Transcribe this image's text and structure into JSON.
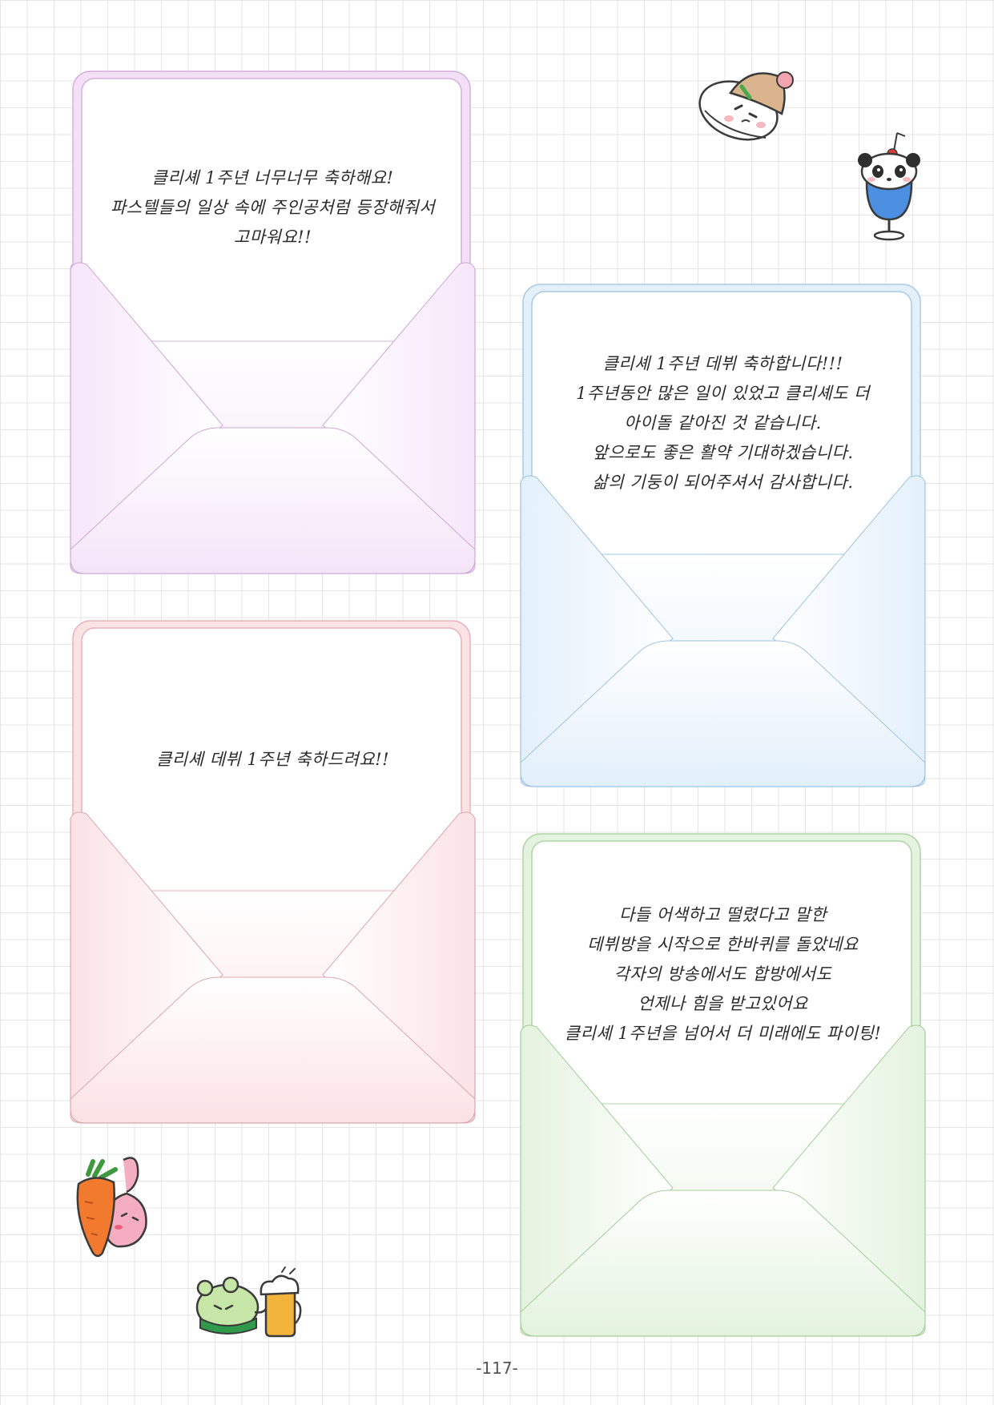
{
  "letters": [
    {
      "color": "#e7c8ef",
      "lines": [
        "클리셰 1주년 너무너무 축하해요!",
        "파스텔들의 일상 속에 주인공처럼 등장해줘서",
        "고마워요!!"
      ]
    },
    {
      "color": "#c9e1f3",
      "lines": [
        "클리셰 1주년 데뷔 축하합니다!!!",
        "1주년동안 많은 일이 있었고 클리셰도 더",
        "아이돌 같아진 것 같습니다.",
        "앞으로도 좋은 활약 기대하겠습니다.",
        "삶의 기둥이 되어주셔서 감사합니다."
      ]
    },
    {
      "color": "#f4cdd1",
      "lines": [
        "클리셰 데뷔 1주년 축하드려요!!"
      ]
    },
    {
      "color": "#cde8c6",
      "lines": [
        "다들 어색하고 떨렸다고 말한",
        "데뷔방을 시작으로 한바퀴를 돌았네요",
        "각자의 방송에서도 합방에서도",
        "언제나 힘을 받고있어요",
        "클리셰 1주년을 넘어서 더 미래에도 파이팅!"
      ]
    }
  ],
  "stickers": [
    {
      "icon": "rice-ball-with-hat-icon"
    },
    {
      "icon": "panda-ice-cream-soda-icon"
    },
    {
      "icon": "carrot-bunny-icon"
    },
    {
      "icon": "hamster-with-beer-icon"
    }
  ],
  "page_number": "-117-"
}
